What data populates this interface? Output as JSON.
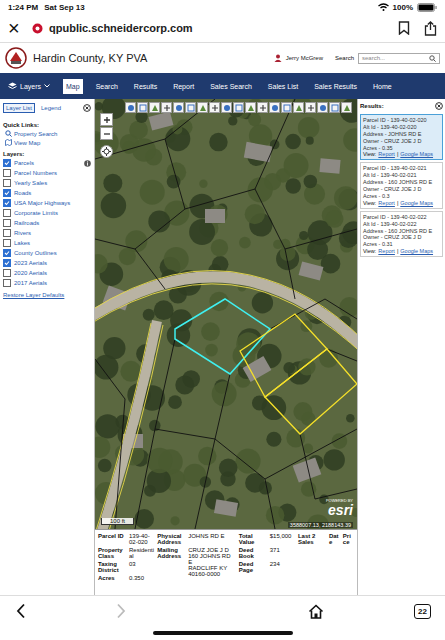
{
  "status_bar": {
    "time": "1:24 PM",
    "date": "Sat Sep 13",
    "battery": "100%",
    "battery_level": 1
  },
  "browser": {
    "close": "×",
    "url": "qpublic.schneidercorp.com",
    "tab_count": "22",
    "forward_disabled": true
  },
  "header": {
    "title": "Hardin County, KY PVA",
    "user": "Jerry McGrew",
    "search_label": "Search",
    "search_placeholder": "search..."
  },
  "nav": [
    {
      "label": "Layers",
      "kind": "menu",
      "selected": false
    },
    {
      "label": "Map",
      "kind": "link",
      "selected": true
    },
    {
      "label": "Search",
      "kind": "link",
      "selected": false
    },
    {
      "label": "Results",
      "kind": "link",
      "selected": false
    },
    {
      "label": "Report",
      "kind": "link",
      "selected": false
    },
    {
      "label": "Sales Search",
      "kind": "link",
      "selected": false
    },
    {
      "label": "Sales List",
      "kind": "link",
      "selected": false
    },
    {
      "label": "Sales Results",
      "kind": "link",
      "selected": false
    },
    {
      "label": "Home",
      "kind": "link",
      "selected": false
    }
  ],
  "left_panel": {
    "tabs": [
      {
        "label": "Layer List",
        "selected": true
      },
      {
        "label": "Legend",
        "selected": false
      }
    ],
    "quick_links_title": "Quick Links:",
    "quick_links": [
      "Property Search",
      "View Map"
    ],
    "layers_title": "Layers:",
    "layers": [
      {
        "label": "Parcels",
        "checked": true,
        "info": true
      },
      {
        "label": "Parcel Numbers",
        "checked": false,
        "info": false
      },
      {
        "label": "Yearly Sales",
        "checked": false,
        "info": false
      },
      {
        "label": "Roads",
        "checked": true,
        "info": false
      },
      {
        "label": "USA Major Highways",
        "checked": true,
        "info": false
      },
      {
        "label": "Corporate Limits",
        "checked": false,
        "info": false
      },
      {
        "label": "Railroads",
        "checked": false,
        "info": false
      },
      {
        "label": "Rivers",
        "checked": false,
        "info": false
      },
      {
        "label": "Lakes",
        "checked": false,
        "info": false
      },
      {
        "label": "County Outlines",
        "checked": true,
        "info": false
      },
      {
        "label": "2023 Aerials",
        "checked": true,
        "info": false
      },
      {
        "label": "2020 Aerials",
        "checked": false,
        "info": false
      },
      {
        "label": "2017 Aerials",
        "checked": false,
        "info": false
      }
    ],
    "restore": "Restore Layer Defaults"
  },
  "map": {
    "scale": "100 ft",
    "powered_by": "POWERED BY",
    "logo": "esri",
    "coordinates": "3588007.13, 2188143.39"
  },
  "results": {
    "title": "Results:",
    "items": [
      {
        "lines": [
          "Parcel ID - 139-40-02-020",
          "Alt Id - 139-40-02-020",
          "Address - JOHNS RD E",
          "Owner - CRUZ JOE J D",
          "Acres - 0.35"
        ],
        "view": "View:",
        "links": [
          "Report",
          "Google Maps"
        ],
        "separator": "|",
        "selected": true
      },
      {
        "lines": [
          "Parcel ID - 139-40-02-021",
          "Alt Id - 139-40-02-021",
          "Address - 160 JOHNS RD E",
          "Owner - CRUZ JOE J D",
          "Acres - 0.3"
        ],
        "view": "View:",
        "links": [
          "Report",
          "Google Maps"
        ],
        "separator": "|",
        "selected": false
      },
      {
        "lines": [
          "Parcel ID - 139-40-02-022",
          "Alt Id - 139-40-02-022",
          "Address - 160 JOHNS RD E",
          "Owner - CRUZ JOE J D",
          "Acres - 0.31"
        ],
        "view": "View:",
        "links": [
          "Report",
          "Google Maps"
        ],
        "separator": "|",
        "selected": false
      }
    ]
  },
  "details": {
    "groups": [
      [
        {
          "label": "Parcel ID",
          "lines": [
            "139-40-02-020"
          ]
        },
        {
          "label": "Property Class",
          "lines": [
            "Residential"
          ]
        },
        {
          "label": "Taxing District",
          "lines": [
            "03"
          ]
        },
        {
          "label": "Acres",
          "lines": [
            "0.350"
          ]
        }
      ],
      [
        {
          "label": "Physical Address",
          "lines": [
            "JOHNS RD E"
          ]
        },
        {
          "label": "Mailing Address",
          "lines": [
            "CRUZ JOE J D",
            "160 JOHNS RD E",
            "RADCLIFF KY 40160-0000"
          ]
        }
      ],
      [
        {
          "label": "Total Value",
          "lines": [
            "$15,000"
          ]
        },
        {
          "label": "Deed Book",
          "lines": [
            "371"
          ]
        },
        {
          "label": "Deed Page",
          "lines": [
            "234"
          ]
        }
      ]
    ],
    "sales": {
      "label": "Last 2 Sales",
      "columns": [
        "Date",
        "Price"
      ]
    }
  }
}
